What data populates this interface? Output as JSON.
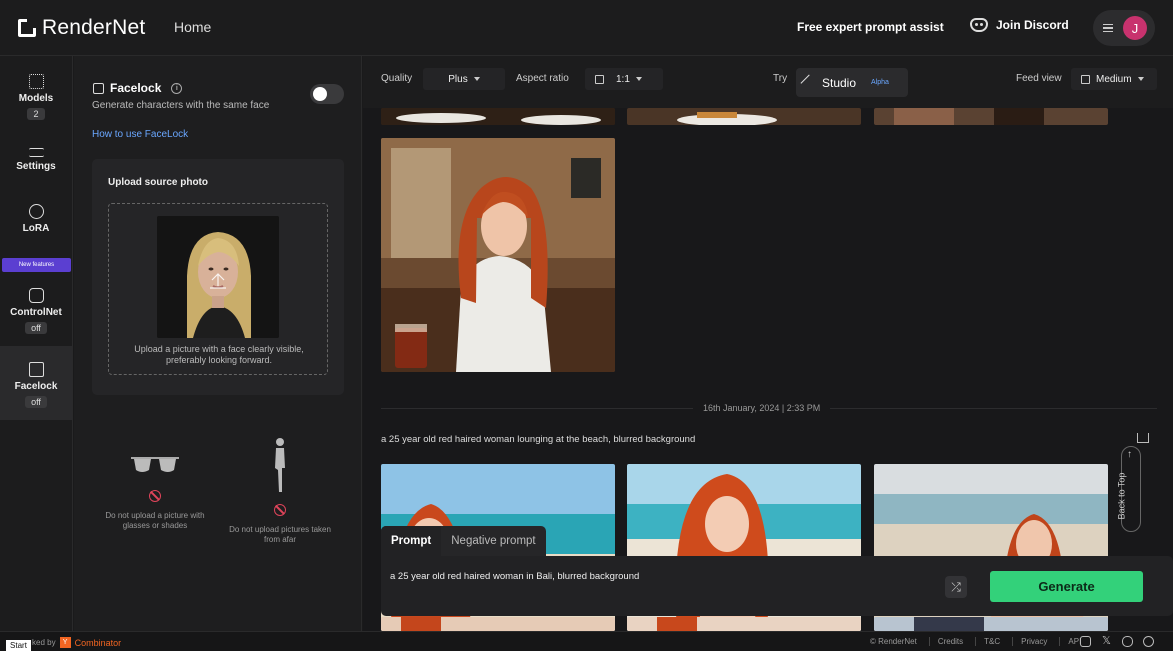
{
  "header": {
    "brand": "RenderNet",
    "home": "Home",
    "prompt_assist": "Free expert prompt assist",
    "discord": "Join Discord",
    "avatar_initial": "J"
  },
  "rail": {
    "items": [
      {
        "label": "Models",
        "badge": "2"
      },
      {
        "label": "Settings"
      },
      {
        "label": "LoRA"
      },
      {
        "label": "ControlNet",
        "badge": "off"
      },
      {
        "label": "Facelock",
        "badge": "off"
      }
    ],
    "new_features": "New features"
  },
  "facelock": {
    "title": "Facelock",
    "subtitle": "Generate characters with the same face",
    "how_to": "How to use FaceLock",
    "upload_title": "Upload source photo",
    "upload_hint": "Upload a picture with a face clearly visible, preferably looking forward.",
    "rule_glasses": "Do not upload a picture with glasses or shades",
    "rule_afar": "Do not upload pictures taken from afar"
  },
  "toolbar": {
    "quality_label": "Quality",
    "quality_value": "Plus",
    "aspect_label": "Aspect ratio",
    "aspect_value": "1:1",
    "try_label": "Try",
    "studio_label": "Studio",
    "alpha_label": "Alpha",
    "feed_view_label": "Feed view",
    "feed_view_value": "Medium"
  },
  "feed": {
    "date": "16th January, 2024 | 2:33 PM",
    "generation_prompt": "a 25 year old red haired woman lounging at the beach, blurred background",
    "back_to_top": "Back to Top"
  },
  "composer": {
    "tab_prompt": "Prompt",
    "tab_negative": "Negative prompt",
    "prompt_value": "a 25 year old red haired woman in Bali, blurred background",
    "generate": "Generate"
  },
  "footer": {
    "backed_by": "ked by",
    "yc": "Combinator",
    "start": "Start",
    "links": [
      "© RenderNet",
      "Credits",
      "T&C",
      "Privacy",
      "API"
    ]
  }
}
